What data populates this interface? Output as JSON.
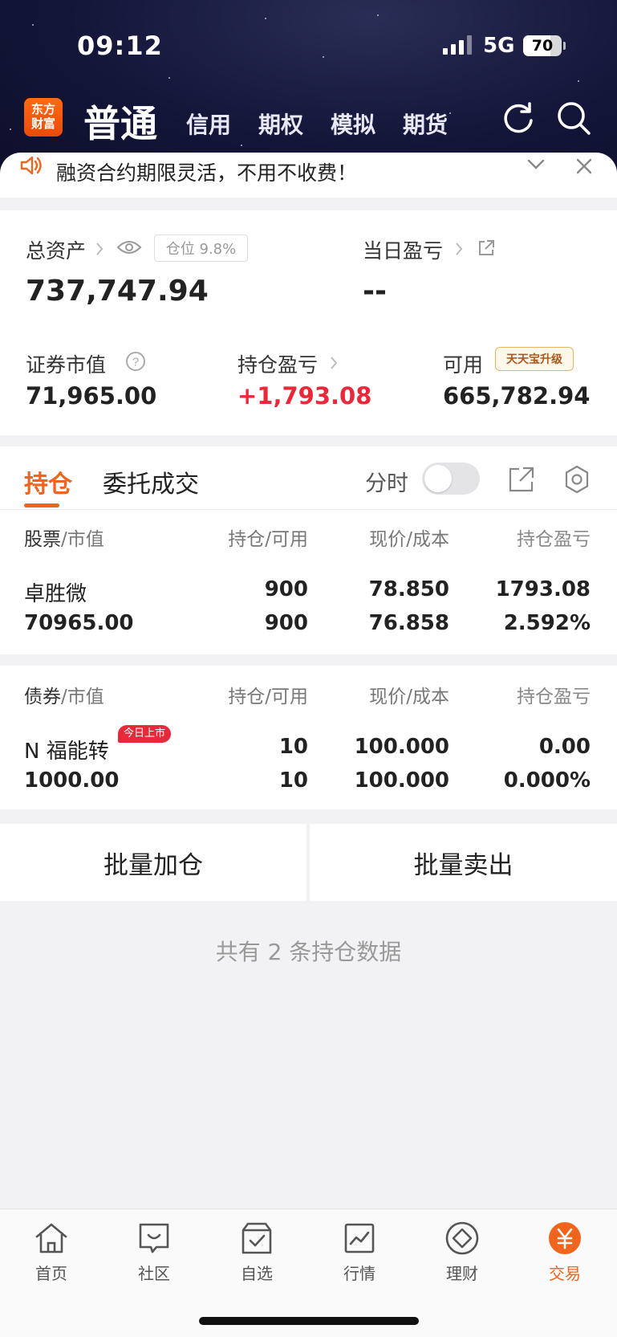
{
  "status_bar": {
    "time": "09:12",
    "network": "5G",
    "battery": "70",
    "battery_level": 0.7
  },
  "header": {
    "logo_line1": "东方",
    "logo_line2": "财富",
    "active_tab": "普通",
    "tabs": [
      "信用",
      "期权",
      "模拟",
      "期货"
    ],
    "icons": [
      "refresh-icon",
      "search-icon"
    ]
  },
  "notice": {
    "text": "融资合约期限灵活，不用不收费！"
  },
  "assets": {
    "total_label": "总资产",
    "position_tag": "仓位 9.8%",
    "total_value": "737,747.94",
    "daily_pl_label": "当日盈亏",
    "daily_pl_value": "--",
    "market_value_label": "证券市值",
    "market_value": "71,965.00",
    "holding_pl_label": "持仓盈亏",
    "holding_pl": "+1,793.08",
    "available_label": "可用",
    "upgrade_badge": "天天宝升级",
    "available": "665,782.94"
  },
  "holdings": {
    "tabs": [
      "持仓",
      "委托成交"
    ],
    "intraday_label": "分时",
    "intraday_on": false,
    "stocks": {
      "header": {
        "name": "股票",
        "name_sub": "/市值",
        "qty": "持仓/可用",
        "price": "现价/成本",
        "pl": "持仓盈亏"
      },
      "rows": [
        {
          "name": "卓胜微",
          "market_value": "70965.00",
          "qty": "900",
          "available": "900",
          "price": "78.850",
          "cost": "76.858",
          "pl": "1793.08",
          "pl_pct": "2.592%"
        }
      ]
    },
    "bonds": {
      "header": {
        "name": "债券",
        "name_sub": "/市值",
        "qty": "持仓/可用",
        "price": "现价/成本",
        "pl": "持仓盈亏"
      },
      "rows": [
        {
          "name": "N 福能转",
          "badge": "今日上市",
          "market_value": "1000.00",
          "qty": "10",
          "available": "10",
          "price": "100.000",
          "cost": "100.000",
          "pl": "0.00",
          "pl_pct": "0.000%"
        }
      ]
    },
    "batch_buy": "批量加仓",
    "batch_sell": "批量卖出",
    "footer": "共有 2 条持仓数据"
  },
  "tabbar": {
    "items": [
      {
        "label": "首页",
        "icon": "home-icon"
      },
      {
        "label": "社区",
        "icon": "community-icon"
      },
      {
        "label": "自选",
        "icon": "watchlist-icon"
      },
      {
        "label": "行情",
        "icon": "market-icon"
      },
      {
        "label": "理财",
        "icon": "wealth-icon"
      },
      {
        "label": "交易",
        "icon": "trade-icon",
        "active": true
      }
    ]
  },
  "colors": {
    "accent": "#f0641e",
    "gain": "#e9283a"
  }
}
